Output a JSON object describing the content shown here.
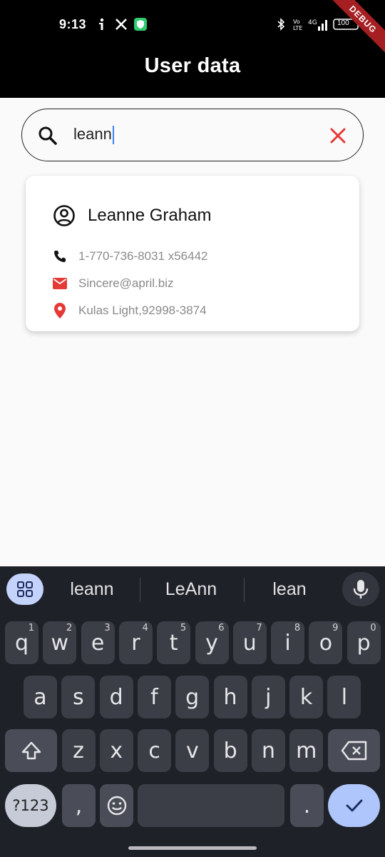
{
  "status_bar": {
    "time": "9:13",
    "battery": "100"
  },
  "app_bar": {
    "title": "User data",
    "debug_label": "DEBUG"
  },
  "search": {
    "value": "leann"
  },
  "user_card": {
    "name": "Leanne Graham",
    "phone": "1-770-736-8031 x56442",
    "email": "Sincere@april.biz",
    "address": "Kulas Light,92998-3874"
  },
  "keyboard": {
    "suggestions": [
      "leann",
      "LeAnn",
      "lean"
    ],
    "row1": [
      {
        "k": "q",
        "n": "1"
      },
      {
        "k": "w",
        "n": "2"
      },
      {
        "k": "e",
        "n": "3"
      },
      {
        "k": "r",
        "n": "4"
      },
      {
        "k": "t",
        "n": "5"
      },
      {
        "k": "y",
        "n": "6"
      },
      {
        "k": "u",
        "n": "7"
      },
      {
        "k": "i",
        "n": "8"
      },
      {
        "k": "o",
        "n": "9"
      },
      {
        "k": "p",
        "n": "0"
      }
    ],
    "row2": [
      "a",
      "s",
      "d",
      "f",
      "g",
      "h",
      "j",
      "k",
      "l"
    ],
    "row3": [
      "z",
      "x",
      "c",
      "v",
      "b",
      "n",
      "m"
    ],
    "symbols_label": "?123",
    "comma": ",",
    "period": "."
  },
  "colors": {
    "accent_red": "#e53935",
    "caret": "#3b82f6",
    "keyboard_bg": "#1f2128"
  }
}
